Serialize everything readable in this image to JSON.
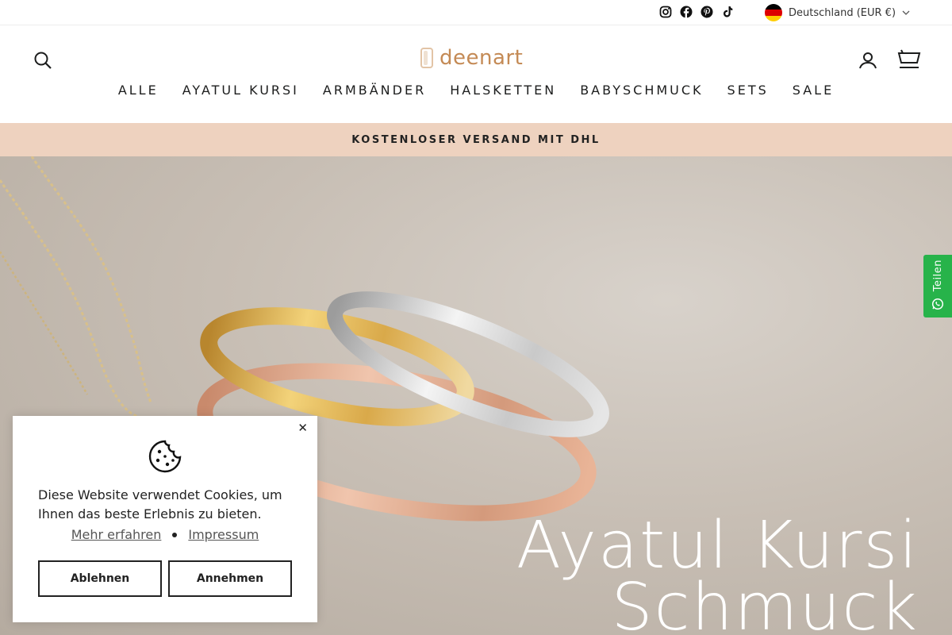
{
  "topbar": {
    "social_icons": [
      "instagram-icon",
      "facebook-icon",
      "pinterest-icon",
      "tiktok-icon"
    ],
    "locale_label": "Deutschland (EUR €)",
    "flag_colors": [
      "#000000",
      "#dd0000",
      "#ffce00"
    ]
  },
  "header": {
    "logo_text": "deenart",
    "icons": [
      "search-icon",
      "account-icon",
      "cart-icon"
    ]
  },
  "nav": {
    "items": [
      "ALLE",
      "AYATUL KURSI",
      "ARMBÄNDER",
      "HALSKETTEN",
      "BABYSCHMUCK",
      "SETS",
      "SALE"
    ]
  },
  "announcement": {
    "text": "KOSTENLOSER VERSAND MIT DHL"
  },
  "hero": {
    "title_line1": "Ayatul Kursi",
    "title_line2": "Schmuck"
  },
  "share": {
    "label": "Teilen",
    "color": "#27b34a"
  },
  "cookie": {
    "message": "Diese Website verwendet Cookies, um Ihnen das beste Erlebnis zu bieten.",
    "link_more": "Mehr erfahren",
    "link_imprint": "Impressum",
    "decline_label": "Ablehnen",
    "accept_label": "Annehmen",
    "close_symbol": "✕"
  },
  "colors": {
    "brand": "#c48a55",
    "announcement_bg": "#eed2bf"
  }
}
